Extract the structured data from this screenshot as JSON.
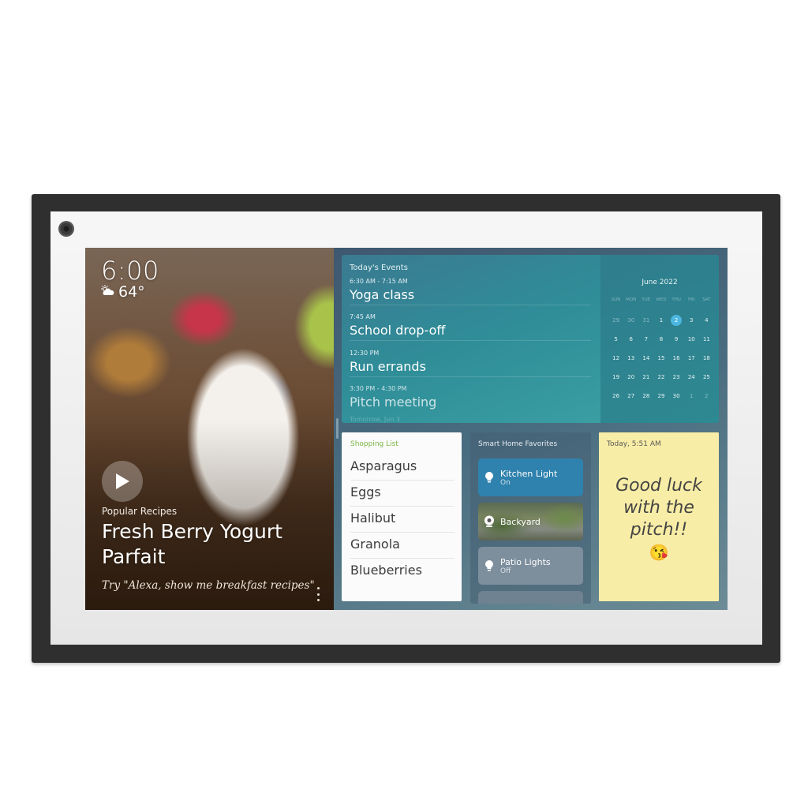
{
  "device": {
    "name": "Smart display"
  },
  "hero": {
    "clock": "6:00",
    "weather_icon": "partly-sunny-icon",
    "temperature": "64°",
    "subtitle": "Popular Recipes",
    "title": "Fresh Berry Yogurt Parfait",
    "hint": "Try \"Alexa, show me breakfast recipes\""
  },
  "events": {
    "heading": "Today's Events",
    "items": [
      {
        "time": "6:30 AM - 7:15 AM",
        "title": "Yoga class"
      },
      {
        "time": "7:45 AM",
        "title": "School drop-off"
      },
      {
        "time": "12:30 PM",
        "title": "Run errands"
      },
      {
        "time": "3:30 PM - 4:30 PM",
        "title": "Pitch meeting"
      }
    ],
    "next_day_label": "Tomorrow, Jun 3"
  },
  "calendar": {
    "month": "June 2022",
    "weekdays": [
      "SUN",
      "MON",
      "TUE",
      "WED",
      "THU",
      "FRI",
      "SAT"
    ],
    "selected_day": "2",
    "weeks": [
      [
        "29",
        "30",
        "31",
        "1",
        "2",
        "3",
        "4"
      ],
      [
        "5",
        "6",
        "7",
        "8",
        "9",
        "10",
        "11"
      ],
      [
        "12",
        "13",
        "14",
        "15",
        "16",
        "17",
        "18"
      ],
      [
        "19",
        "20",
        "21",
        "22",
        "23",
        "24",
        "25"
      ],
      [
        "26",
        "27",
        "28",
        "29",
        "30",
        "1",
        "2"
      ]
    ]
  },
  "shopping": {
    "heading": "Shopping List",
    "items": [
      "Asparagus",
      "Eggs",
      "Halibut",
      "Granola",
      "Blueberries"
    ],
    "accent": "#7ab540"
  },
  "smart_home": {
    "heading": "Smart Home Favorites",
    "devices": [
      {
        "name": "Kitchen Light",
        "state": "On",
        "icon": "lightbulb-icon",
        "color": "#2f82ad"
      },
      {
        "name": "Backyard",
        "state": "",
        "icon": "camera-icon"
      },
      {
        "name": "Patio Lights",
        "state": "Off",
        "icon": "lightbulb-icon"
      }
    ]
  },
  "note": {
    "timestamp": "Today, 5:51 AM",
    "text": "Good luck with the pitch!!",
    "emoji": "😘",
    "color": "#f8eda6"
  }
}
